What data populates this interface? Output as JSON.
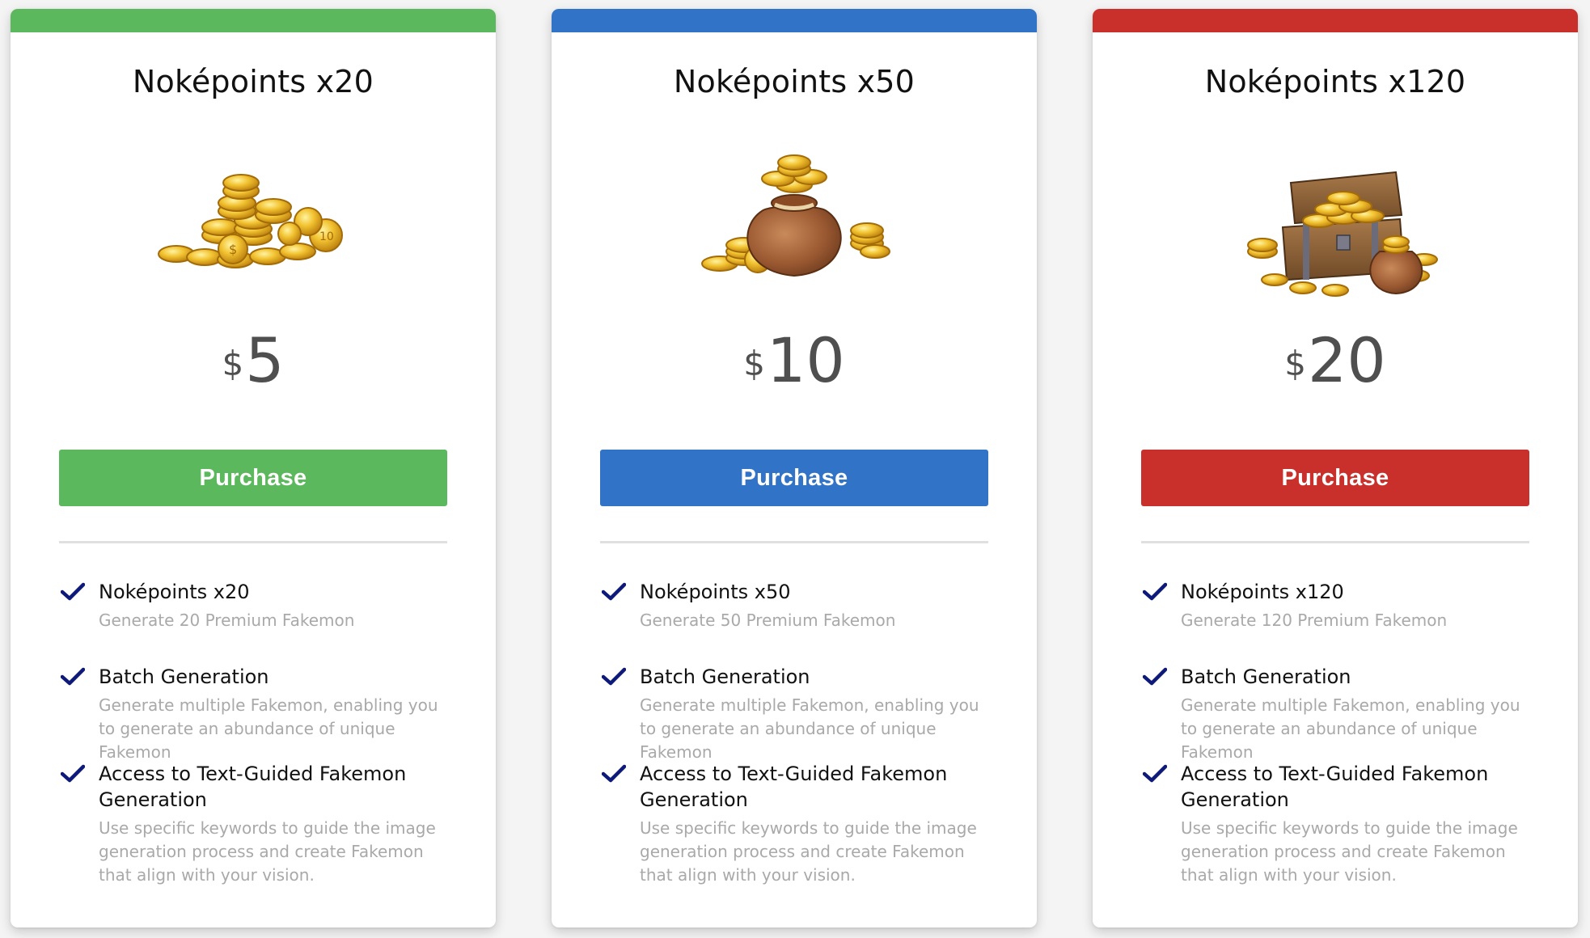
{
  "purchase_label": "Purchase",
  "plans": [
    {
      "title": "Noképoints x20",
      "currency": "$",
      "price": "5",
      "accent": "#5cb85c",
      "art": "coin-pile",
      "features": [
        {
          "title": "Noképoints x20",
          "desc": "Generate 20 Premium Fakemon"
        },
        {
          "title": "Batch Generation",
          "desc": "Generate multiple Fakemon, enabling you to generate an abundance of unique Fakemon"
        },
        {
          "title": "Access to Text-Guided Fakemon Generation",
          "desc": "Use specific keywords to guide the image generation process and create Fakemon that align with your vision."
        }
      ]
    },
    {
      "title": "Noképoints x50",
      "currency": "$",
      "price": "10",
      "accent": "#3174c7",
      "art": "coin-bag",
      "features": [
        {
          "title": "Noképoints x50",
          "desc": "Generate 50 Premium Fakemon"
        },
        {
          "title": "Batch Generation",
          "desc": "Generate multiple Fakemon, enabling you to generate an abundance of unique Fakemon"
        },
        {
          "title": "Access to Text-Guided Fakemon Generation",
          "desc": "Use specific keywords to guide the image generation process and create Fakemon that align with your vision."
        }
      ]
    },
    {
      "title": "Noképoints x120",
      "currency": "$",
      "price": "20",
      "accent": "#c9302c",
      "art": "treasure-chest",
      "features": [
        {
          "title": "Noképoints x120",
          "desc": "Generate 120 Premium Fakemon"
        },
        {
          "title": "Batch Generation",
          "desc": "Generate multiple Fakemon, enabling you to generate an abundance of unique Fakemon"
        },
        {
          "title": "Access to Text-Guided Fakemon Generation",
          "desc": "Use specific keywords to guide the image generation process and create Fakemon that align with your vision."
        }
      ]
    }
  ],
  "check_icon_color": "#0d1a7a"
}
